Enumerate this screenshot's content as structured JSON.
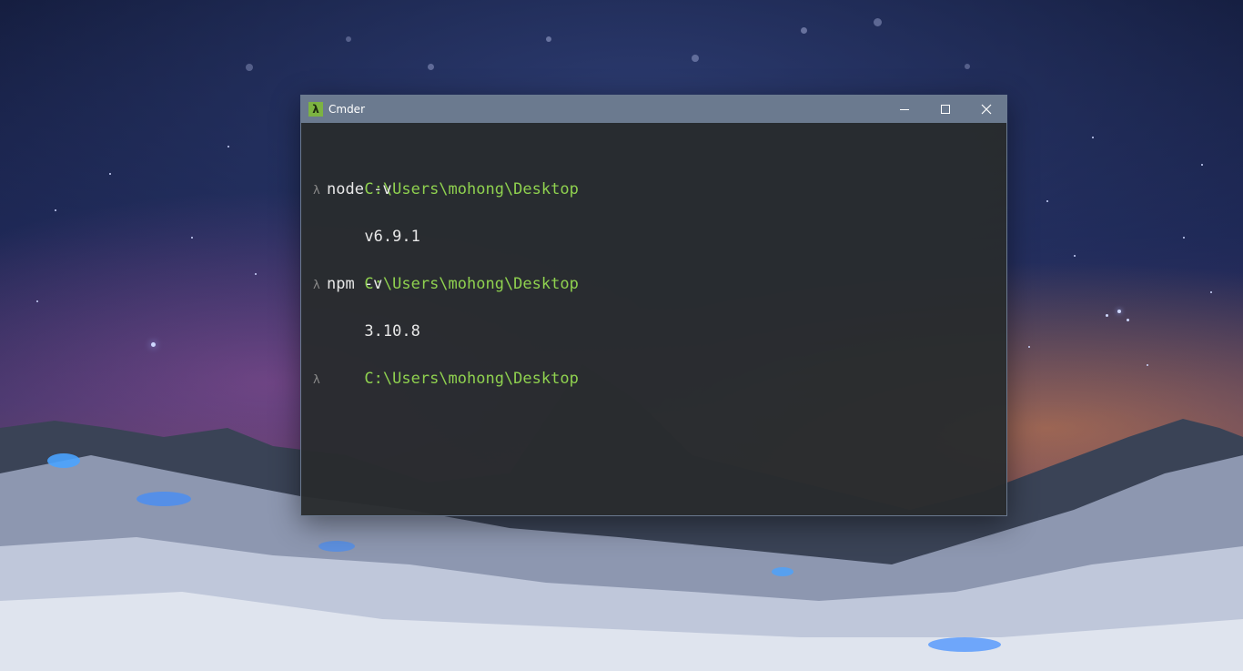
{
  "window": {
    "title": "Cmder",
    "app_icon_glyph": "λ",
    "controls": {
      "minimize": "minimize-icon",
      "maximize": "maximize-icon",
      "close": "close-icon"
    }
  },
  "console": {
    "prompt_symbol": "λ",
    "blocks": [
      {
        "path": "C:\\Users\\mohong\\Desktop",
        "command": "node -v",
        "output": "v6.9.1"
      },
      {
        "path": "C:\\Users\\mohong\\Desktop",
        "command": "npm -v",
        "output": "3.10.8"
      },
      {
        "path": "C:\\Users\\mohong\\Desktop",
        "command": "",
        "output": ""
      }
    ]
  },
  "colors": {
    "path_green": "#8fd14f",
    "titlebar": "#6b7a8f",
    "console_bg": "#2b2e30",
    "icon_green": "#7cb342"
  }
}
